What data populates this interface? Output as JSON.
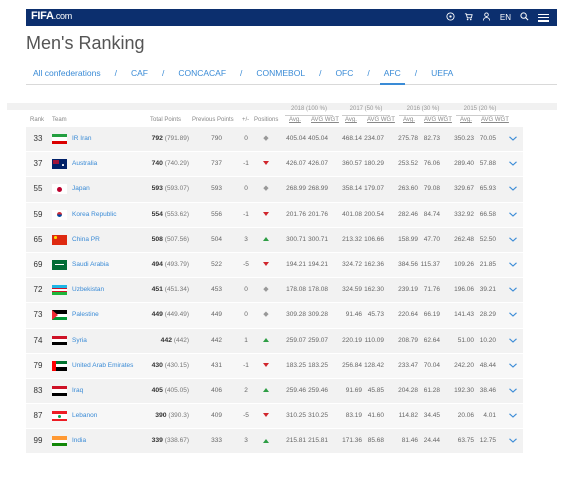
{
  "header": {
    "logo": "FIFA",
    "logo_suffix": ".com",
    "lang": "EN",
    "icons": [
      "ball-icon",
      "cart-icon",
      "user-icon",
      "search-icon",
      "menu-icon"
    ]
  },
  "page": {
    "title": "Men's Ranking"
  },
  "tabs": [
    {
      "label": "All confederations",
      "active": false
    },
    {
      "label": "CAF",
      "active": false
    },
    {
      "label": "CONCACAF",
      "active": false
    },
    {
      "label": "CONMEBOL",
      "active": false
    },
    {
      "label": "OFC",
      "active": false
    },
    {
      "label": "AFC",
      "active": true
    },
    {
      "label": "UEFA",
      "active": false
    }
  ],
  "table": {
    "years": [
      "2018 (100 %)",
      "2017 (50 %)",
      "2016 (30 %)",
      "2015 (20 %)"
    ],
    "headers": {
      "rank": "Rank",
      "team": "Team",
      "total": "Total Points",
      "previous": "Previous Points",
      "delta": "+/-",
      "positions": "Positions",
      "avg": "Avg.",
      "avg_wgt": "AVG WGT"
    },
    "rows": [
      {
        "rank": "33",
        "team": "IR Iran",
        "flag": "iran",
        "pts": "792",
        "pts_exact": "(791.89)",
        "prev": "790",
        "delta": "0",
        "trend": "same",
        "v": [
          "405.04",
          "405.04",
          "468.14",
          "234.07",
          "275.78",
          "82.73",
          "350.23",
          "70.05"
        ]
      },
      {
        "rank": "37",
        "team": "Australia",
        "flag": "australia",
        "pts": "740",
        "pts_exact": "(740.29)",
        "prev": "737",
        "delta": "-1",
        "trend": "down",
        "v": [
          "426.07",
          "426.07",
          "360.57",
          "180.29",
          "253.52",
          "76.06",
          "289.40",
          "57.88"
        ]
      },
      {
        "rank": "55",
        "team": "Japan",
        "flag": "japan",
        "pts": "593",
        "pts_exact": "(593.07)",
        "prev": "593",
        "delta": "0",
        "trend": "same",
        "v": [
          "268.99",
          "268.99",
          "358.14",
          "179.07",
          "263.60",
          "79.08",
          "329.67",
          "65.93"
        ]
      },
      {
        "rank": "59",
        "team": "Korea Republic",
        "flag": "korea",
        "pts": "554",
        "pts_exact": "(553.62)",
        "prev": "556",
        "delta": "-1",
        "trend": "down",
        "v": [
          "201.76",
          "201.76",
          "401.08",
          "200.54",
          "282.46",
          "84.74",
          "332.92",
          "66.58"
        ]
      },
      {
        "rank": "65",
        "team": "China PR",
        "flag": "china",
        "pts": "508",
        "pts_exact": "(507.56)",
        "prev": "504",
        "delta": "3",
        "trend": "up",
        "v": [
          "300.71",
          "300.71",
          "213.32",
          "106.66",
          "158.99",
          "47.70",
          "262.48",
          "52.50"
        ]
      },
      {
        "rank": "69",
        "team": "Saudi Arabia",
        "flag": "saudi",
        "pts": "494",
        "pts_exact": "(493.79)",
        "prev": "522",
        "delta": "-5",
        "trend": "down",
        "v": [
          "194.21",
          "194.21",
          "324.72",
          "162.36",
          "384.56",
          "115.37",
          "109.26",
          "21.85"
        ]
      },
      {
        "rank": "72",
        "team": "Uzbekistan",
        "flag": "uzbekistan",
        "pts": "451",
        "pts_exact": "(451.34)",
        "prev": "453",
        "delta": "0",
        "trend": "same",
        "v": [
          "178.08",
          "178.08",
          "324.59",
          "162.30",
          "239.19",
          "71.76",
          "196.06",
          "39.21"
        ]
      },
      {
        "rank": "73",
        "team": "Palestine",
        "flag": "palestine",
        "pts": "449",
        "pts_exact": "(449.49)",
        "prev": "449",
        "delta": "0",
        "trend": "same",
        "v": [
          "309.28",
          "309.28",
          "91.46",
          "45.73",
          "220.64",
          "66.19",
          "141.43",
          "28.29"
        ]
      },
      {
        "rank": "74",
        "team": "Syria",
        "flag": "syria",
        "pts": "442",
        "pts_exact": "(442)",
        "prev": "442",
        "delta": "1",
        "trend": "up",
        "v": [
          "259.07",
          "259.07",
          "220.19",
          "110.09",
          "208.79",
          "62.64",
          "51.00",
          "10.20"
        ]
      },
      {
        "rank": "79",
        "team": "United Arab Emirates",
        "flag": "uae",
        "pts": "430",
        "pts_exact": "(430.15)",
        "prev": "431",
        "delta": "-1",
        "trend": "down",
        "v": [
          "183.25",
          "183.25",
          "256.84",
          "128.42",
          "233.47",
          "70.04",
          "242.20",
          "48.44"
        ]
      },
      {
        "rank": "83",
        "team": "Iraq",
        "flag": "iraq",
        "pts": "405",
        "pts_exact": "(405.05)",
        "prev": "406",
        "delta": "2",
        "trend": "up",
        "v": [
          "259.46",
          "259.46",
          "91.69",
          "45.85",
          "204.28",
          "61.28",
          "192.30",
          "38.46"
        ]
      },
      {
        "rank": "87",
        "team": "Lebanon",
        "flag": "lebanon",
        "pts": "390",
        "pts_exact": "(390.3)",
        "prev": "409",
        "delta": "-5",
        "trend": "down",
        "v": [
          "310.25",
          "310.25",
          "83.19",
          "41.60",
          "114.82",
          "34.45",
          "20.06",
          "4.01"
        ]
      },
      {
        "rank": "99",
        "team": "India",
        "flag": "india",
        "pts": "339",
        "pts_exact": "(338.67)",
        "prev": "333",
        "delta": "3",
        "trend": "up",
        "v": [
          "215.81",
          "215.81",
          "171.36",
          "85.68",
          "81.46",
          "24.44",
          "63.75",
          "12.75"
        ]
      }
    ]
  }
}
